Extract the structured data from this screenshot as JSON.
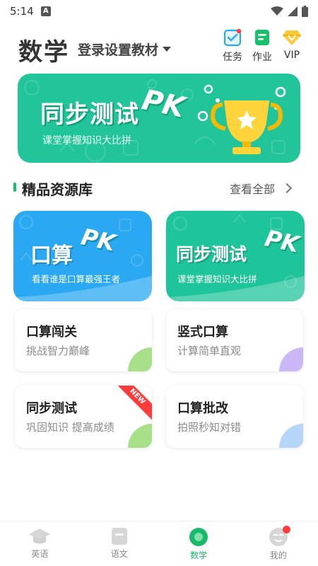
{
  "status_bar": {
    "time": "5:14",
    "notification_icon": "A"
  },
  "header": {
    "subject": "数学",
    "textbook_label": "登录设置教材",
    "task_label": "任务",
    "homework_label": "作业",
    "vip_label": "VIP"
  },
  "banner": {
    "title": "同步测试",
    "pk": "PK",
    "subtitle": "课堂掌握知识大比拼"
  },
  "section": {
    "title": "精品资源库",
    "more_label": "查看全部"
  },
  "cards_large": [
    {
      "title": "口算",
      "pk": "PK",
      "subtitle": "看看谁是口算最强王者"
    },
    {
      "title": "同步测试",
      "pk": "PK",
      "subtitle": "课堂掌握知识大比拼"
    }
  ],
  "cards_small": [
    {
      "title": "口算闯关",
      "subtitle": "挑战智力巅峰",
      "accent": "#a8e08a"
    },
    {
      "title": "竖式口算",
      "subtitle": "计算简单直观",
      "accent": "#c9b8f5"
    },
    {
      "title": "同步测试",
      "subtitle": "巩固知识 提高成绩",
      "accent": "#a8e08a",
      "badge": "NEW"
    },
    {
      "title": "口算批改",
      "subtitle": "拍照秒知对错",
      "accent": "#b5d6f8"
    }
  ],
  "bottom_nav": [
    {
      "label": "英语",
      "active": false
    },
    {
      "label": "语文",
      "active": false
    },
    {
      "label": "数学",
      "active": true
    },
    {
      "label": "我的",
      "active": false
    }
  ],
  "colors": {
    "brand_green": "#17b96a",
    "banner_green": "#22c59a",
    "card_blue": "#2aa8f2",
    "badge_red": "#ff3b3b"
  }
}
